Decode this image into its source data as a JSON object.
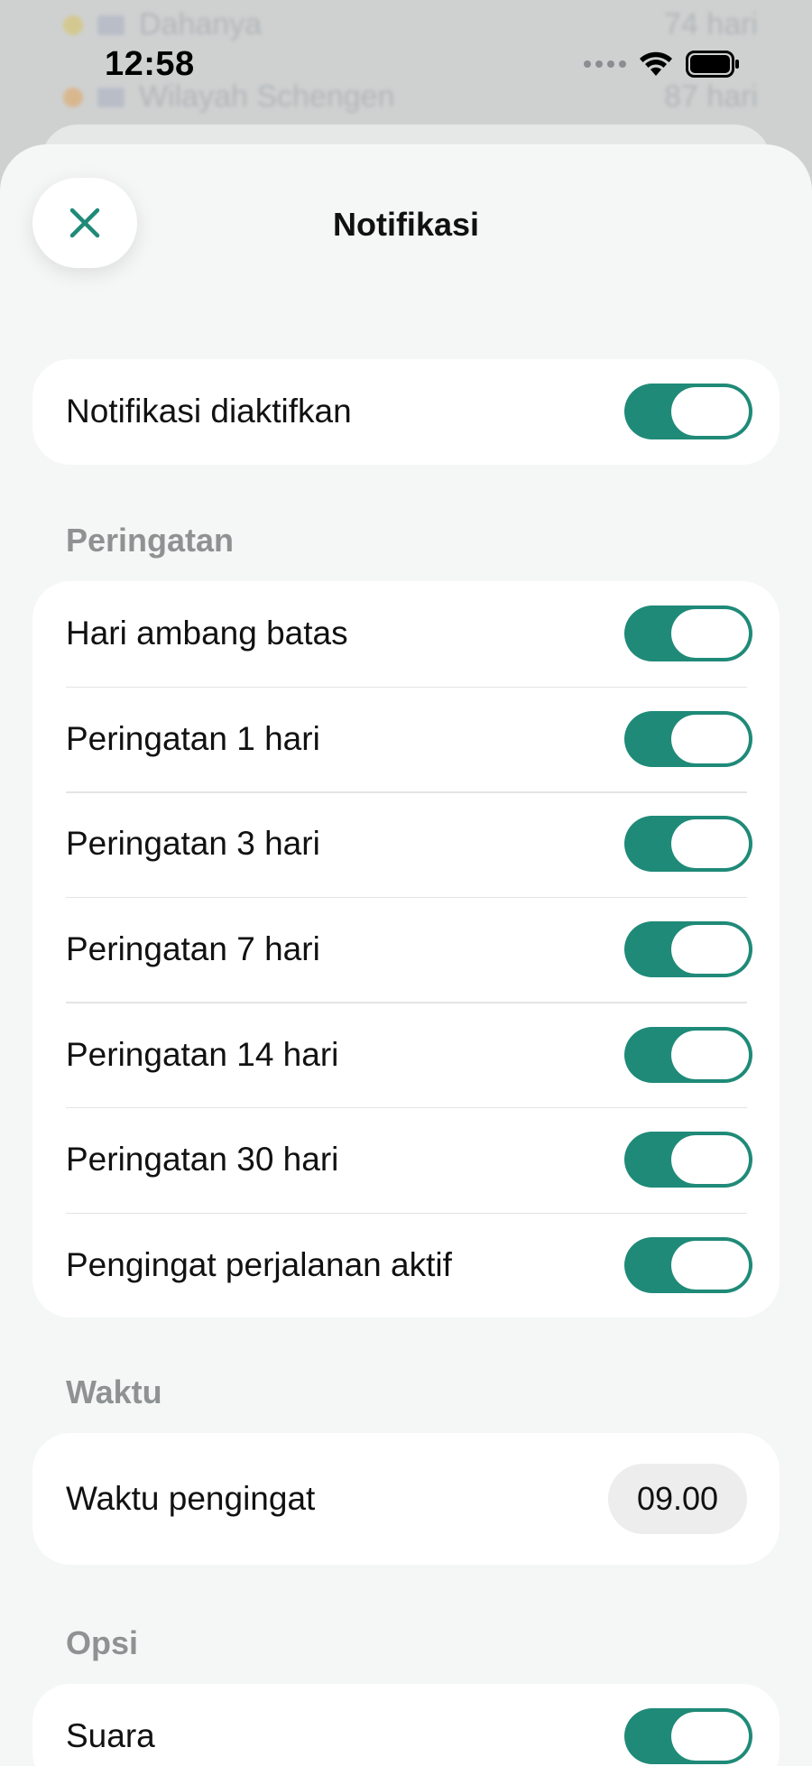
{
  "status_bar": {
    "time": "12:58"
  },
  "background": {
    "rows": [
      {
        "label": "Dahanya",
        "right": "74 hari"
      },
      {
        "label": "Wilayah Schengen",
        "right": "87 hari"
      }
    ]
  },
  "sheet": {
    "title": "Notifikasi"
  },
  "main_toggle": {
    "label": "Notifikasi diaktifkan",
    "on": true
  },
  "sections": {
    "warnings": {
      "label": "Peringatan",
      "items": [
        {
          "label": "Hari ambang batas",
          "on": true
        },
        {
          "label": "Peringatan 1 hari",
          "on": true
        },
        {
          "label": "Peringatan 3 hari",
          "on": true
        },
        {
          "label": "Peringatan 7 hari",
          "on": true
        },
        {
          "label": "Peringatan 14 hari",
          "on": true
        },
        {
          "label": "Peringatan 30 hari",
          "on": true
        },
        {
          "label": "Pengingat perjalanan aktif",
          "on": true
        }
      ]
    },
    "time": {
      "label": "Waktu",
      "reminder_label": "Waktu pengingat",
      "reminder_value": "09.00"
    },
    "options": {
      "label": "Opsi",
      "items": [
        {
          "label": "Suara",
          "on": true
        }
      ]
    }
  },
  "colors": {
    "accent": "#1f8a78",
    "background": "#f5f6f6",
    "section_label": "#8e9293"
  },
  "icons": {
    "close": "close-icon",
    "wifi": "wifi-icon",
    "battery": "battery-icon"
  }
}
